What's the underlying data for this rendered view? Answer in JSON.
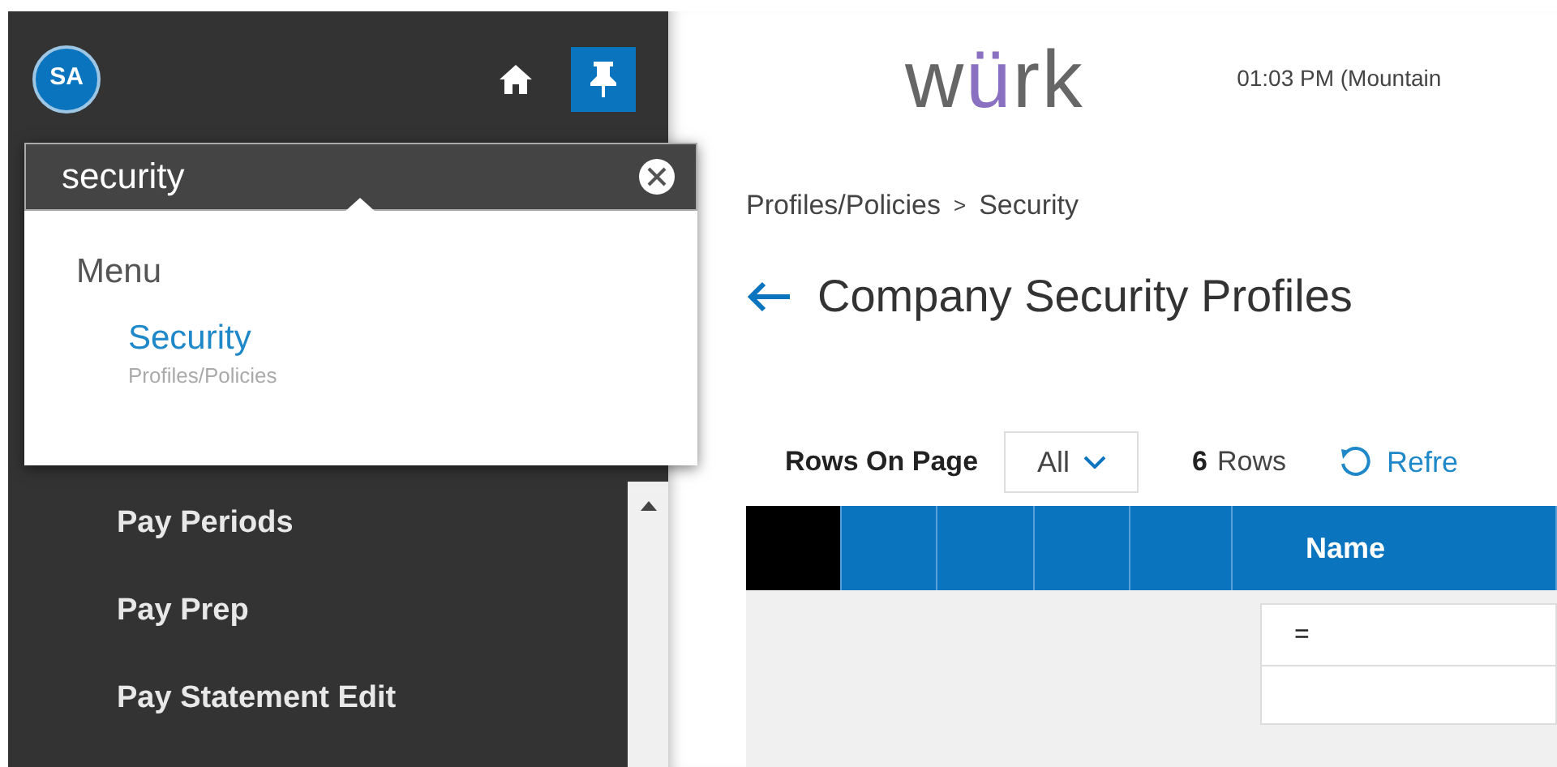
{
  "user": {
    "initials": "SA"
  },
  "sidebar_toolbar": {
    "pinned": true
  },
  "search": {
    "value": "security"
  },
  "search_results": {
    "group": "Menu",
    "items": [
      {
        "title": "Security",
        "subtitle": "Profiles/Policies"
      }
    ]
  },
  "nav_items": [
    {
      "label": "Pay Periods"
    },
    {
      "label": "Pay Prep"
    },
    {
      "label": "Pay Statement Edit"
    }
  ],
  "header": {
    "logo": {
      "before": "w",
      "accent": "ü",
      "after": "rk"
    },
    "time": "01:03 PM (Mountain"
  },
  "breadcrumb": {
    "parent": "Profiles/Policies",
    "separator": ">",
    "current": "Security"
  },
  "page_title": "Company Security Profiles",
  "table_toolbar": {
    "rows_on_page_label": "Rows On Page",
    "rows_on_page_value": "All",
    "row_count": "6",
    "row_count_unit": "Rows",
    "refresh_label": "Refre"
  },
  "table": {
    "columns": [
      {
        "kind": "corner"
      },
      {
        "kind": "blank"
      },
      {
        "kind": "blank"
      },
      {
        "kind": "blank"
      },
      {
        "kind": "blank"
      },
      {
        "kind": "label",
        "label": "Name"
      }
    ],
    "filter": {
      "operator": "="
    }
  }
}
